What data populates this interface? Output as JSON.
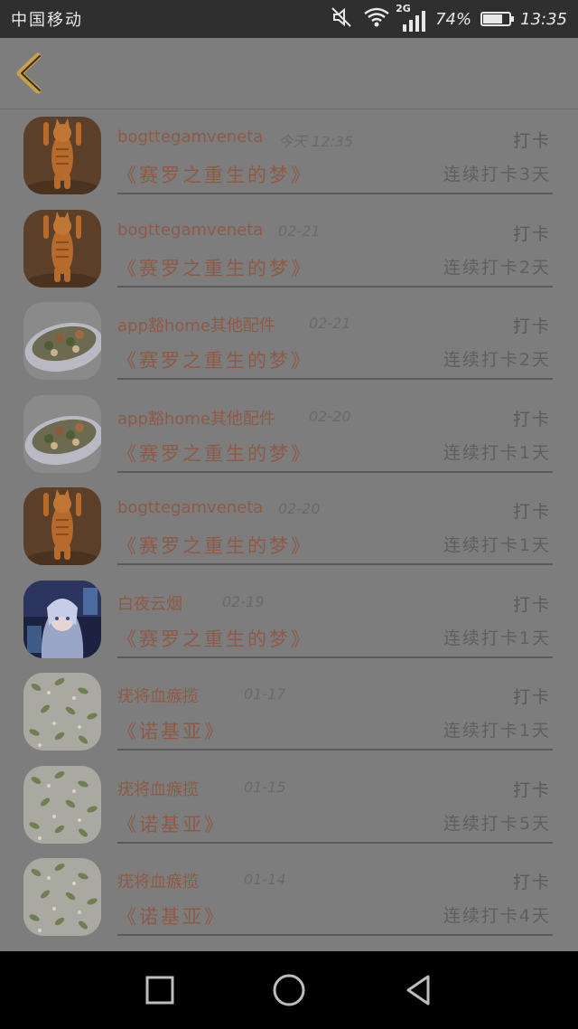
{
  "status_bar": {
    "carrier": "中国移动",
    "network": "2G",
    "battery": "74%",
    "battery_level": 0.74,
    "time": "13:35"
  },
  "colors": {
    "accent_text": "#8e5a45",
    "back_arrow": "#c9a14a",
    "overlay_background": "#7d7d7d"
  },
  "header": {
    "back_icon": "chevron-left-icon"
  },
  "records": [
    {
      "name": "bogttegamveneta",
      "date": "今天 12:35",
      "action": "打卡",
      "book": "《赛罗之重生的梦》",
      "streak": "连续打卡3天",
      "avatar": "cat"
    },
    {
      "name": "bogttegamveneta",
      "date": "02-21",
      "action": "打卡",
      "book": "《赛罗之重生的梦》",
      "streak": "连续打卡2天",
      "avatar": "cat"
    },
    {
      "name": "app豁home其他配件",
      "date": "02-21",
      "action": "打卡",
      "book": "《赛罗之重生的梦》",
      "streak": "连续打卡2天",
      "avatar": "food"
    },
    {
      "name": "app豁home其他配件",
      "date": "02-20",
      "action": "打卡",
      "book": "《赛罗之重生的梦》",
      "streak": "连续打卡1天",
      "avatar": "food"
    },
    {
      "name": "bogttegamveneta",
      "date": "02-20",
      "action": "打卡",
      "book": "《赛罗之重生的梦》",
      "streak": "连续打卡1天",
      "avatar": "cat"
    },
    {
      "name": "白夜云烟",
      "date": "02-19",
      "action": "打卡",
      "book": "《赛罗之重生的梦》",
      "streak": "连续打卡1天",
      "avatar": "anime"
    },
    {
      "name": "疣将血瘯揽",
      "date": "01-17",
      "action": "打卡",
      "book": "《诺基亚》",
      "streak": "连续打卡1天",
      "avatar": "pattern"
    },
    {
      "name": "疣将血瘯揽",
      "date": "01-15",
      "action": "打卡",
      "book": "《诺基亚》",
      "streak": "连续打卡5天",
      "avatar": "pattern"
    },
    {
      "name": "疣将血瘯揽",
      "date": "01-14",
      "action": "打卡",
      "book": "《诺基亚》",
      "streak": "连续打卡4天",
      "avatar": "pattern"
    }
  ],
  "nav_bar": {
    "recents_icon": "square-icon",
    "home_icon": "circle-icon",
    "back_icon": "triangle-back-icon"
  }
}
